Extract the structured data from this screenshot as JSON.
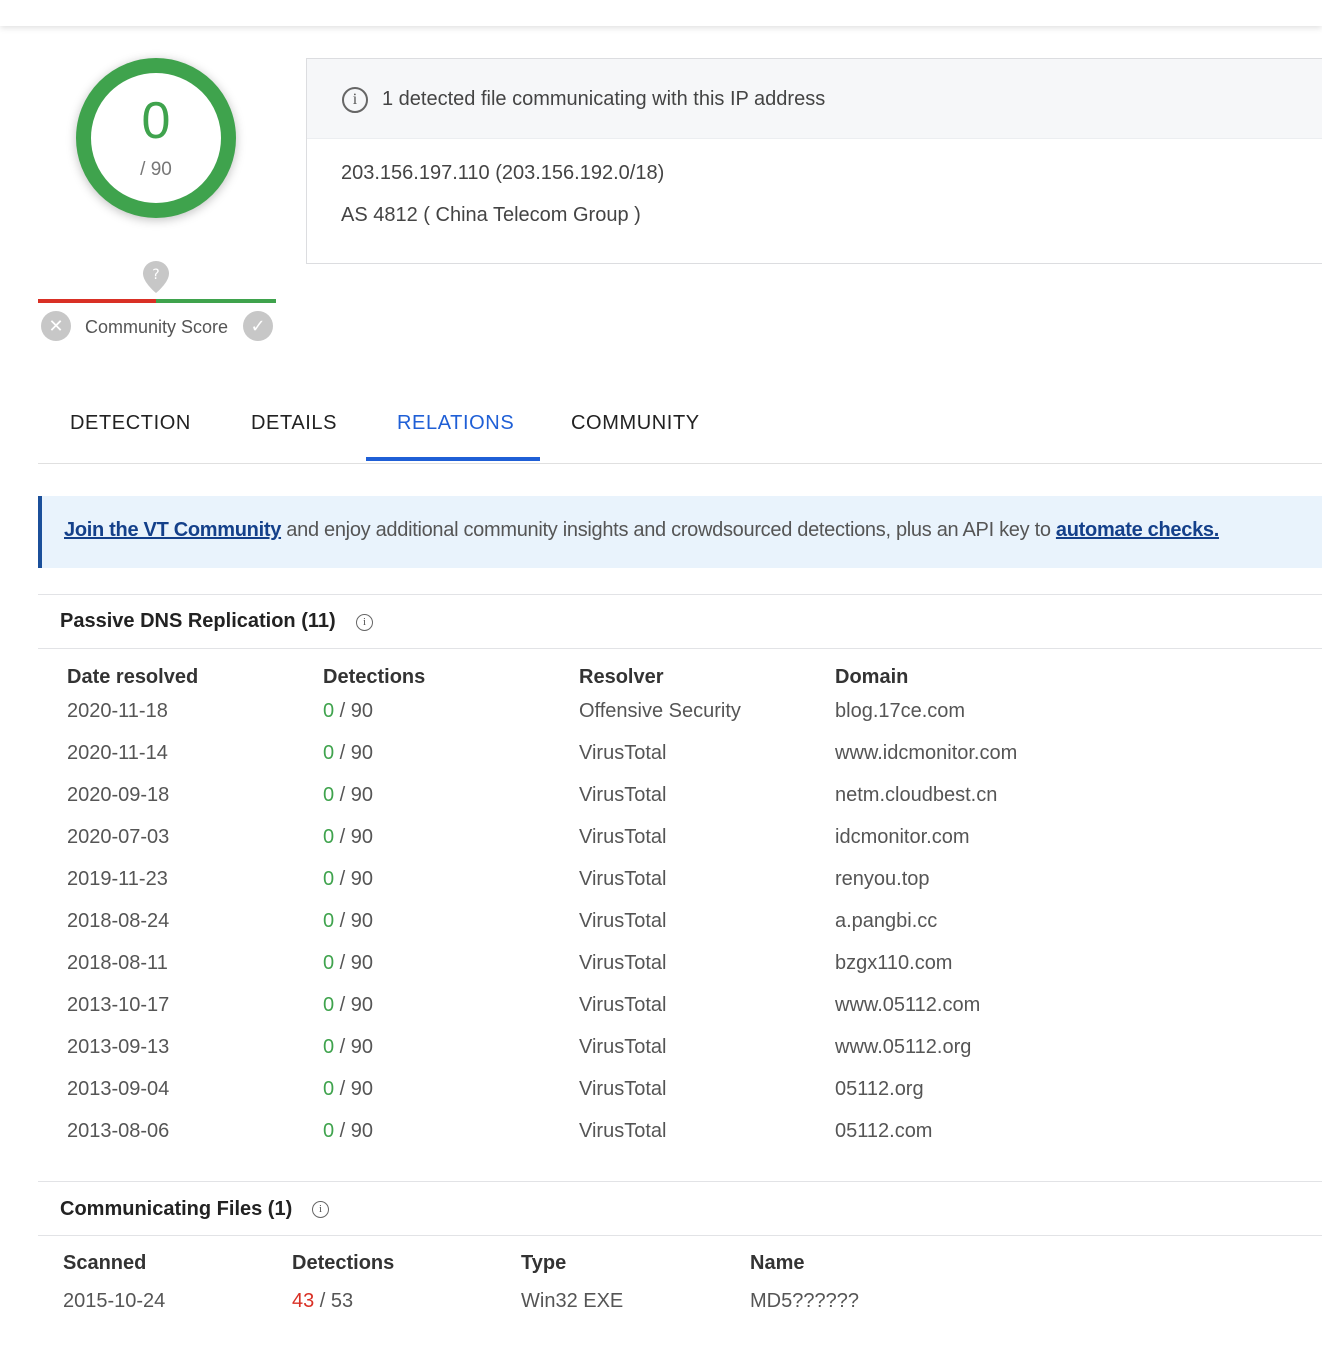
{
  "score": {
    "value": "0",
    "total": "/ 90",
    "color": "#3fa34d"
  },
  "community": {
    "label": "Community Score",
    "pin_icon": "question-pin-icon",
    "down_icon": "x-icon",
    "up_icon": "check-icon"
  },
  "info": {
    "headline": "1 detected file communicating with this IP address",
    "ip_line": "203.156.197.110  (203.156.192.0/18)",
    "as_line": "AS 4812  ( China Telecom Group )"
  },
  "tabs": [
    {
      "label": "DETECTION"
    },
    {
      "label": "DETAILS"
    },
    {
      "label": "RELATIONS",
      "active": true
    },
    {
      "label": "COMMUNITY"
    }
  ],
  "banner": {
    "link1": "Join the VT Community",
    "middle": " and enjoy additional community insights and crowdsourced detections, plus an API key to ",
    "link2": "automate checks."
  },
  "passive_dns": {
    "title": "Passive DNS Replication  (11)",
    "headers": [
      "Date resolved",
      "Detections",
      "Resolver",
      "Domain"
    ],
    "rows": [
      {
        "date": "2020-11-18",
        "det": "0",
        "total": " / 90",
        "resolver": "Offensive Security",
        "domain": "blog.17ce.com"
      },
      {
        "date": "2020-11-14",
        "det": "0",
        "total": " / 90",
        "resolver": "VirusTotal",
        "domain": "www.idcmonitor.com"
      },
      {
        "date": "2020-09-18",
        "det": "0",
        "total": " / 90",
        "resolver": "VirusTotal",
        "domain": "netm.cloudbest.cn"
      },
      {
        "date": "2020-07-03",
        "det": "0",
        "total": " / 90",
        "resolver": "VirusTotal",
        "domain": "idcmonitor.com"
      },
      {
        "date": "2019-11-23",
        "det": "0",
        "total": " / 90",
        "resolver": "VirusTotal",
        "domain": "renyou.top"
      },
      {
        "date": "2018-08-24",
        "det": "0",
        "total": " / 90",
        "resolver": "VirusTotal",
        "domain": "a.pangbi.cc"
      },
      {
        "date": "2018-08-11",
        "det": "0",
        "total": " / 90",
        "resolver": "VirusTotal",
        "domain": "bzgx110.com"
      },
      {
        "date": "2013-10-17",
        "det": "0",
        "total": " / 90",
        "resolver": "VirusTotal",
        "domain": "www.05112.com"
      },
      {
        "date": "2013-09-13",
        "det": "0",
        "total": " / 90",
        "resolver": "VirusTotal",
        "domain": "www.05112.org"
      },
      {
        "date": "2013-09-04",
        "det": "0",
        "total": " / 90",
        "resolver": "VirusTotal",
        "domain": "05112.org"
      },
      {
        "date": "2013-08-06",
        "det": "0",
        "total": " / 90",
        "resolver": "VirusTotal",
        "domain": "05112.com"
      }
    ]
  },
  "communicating_files": {
    "title": "Communicating Files  (1)",
    "headers": [
      "Scanned",
      "Detections",
      "Type",
      "Name"
    ],
    "rows": [
      {
        "scanned": "2015-10-24",
        "det": "43",
        "total": " / 53",
        "type": "Win32 EXE",
        "name": "MD5??????"
      }
    ]
  },
  "colors": {
    "accent": "#1f5fd6",
    "good": "#3fa34d",
    "bad": "#d93025",
    "banner_bg": "#e9f3fc"
  }
}
